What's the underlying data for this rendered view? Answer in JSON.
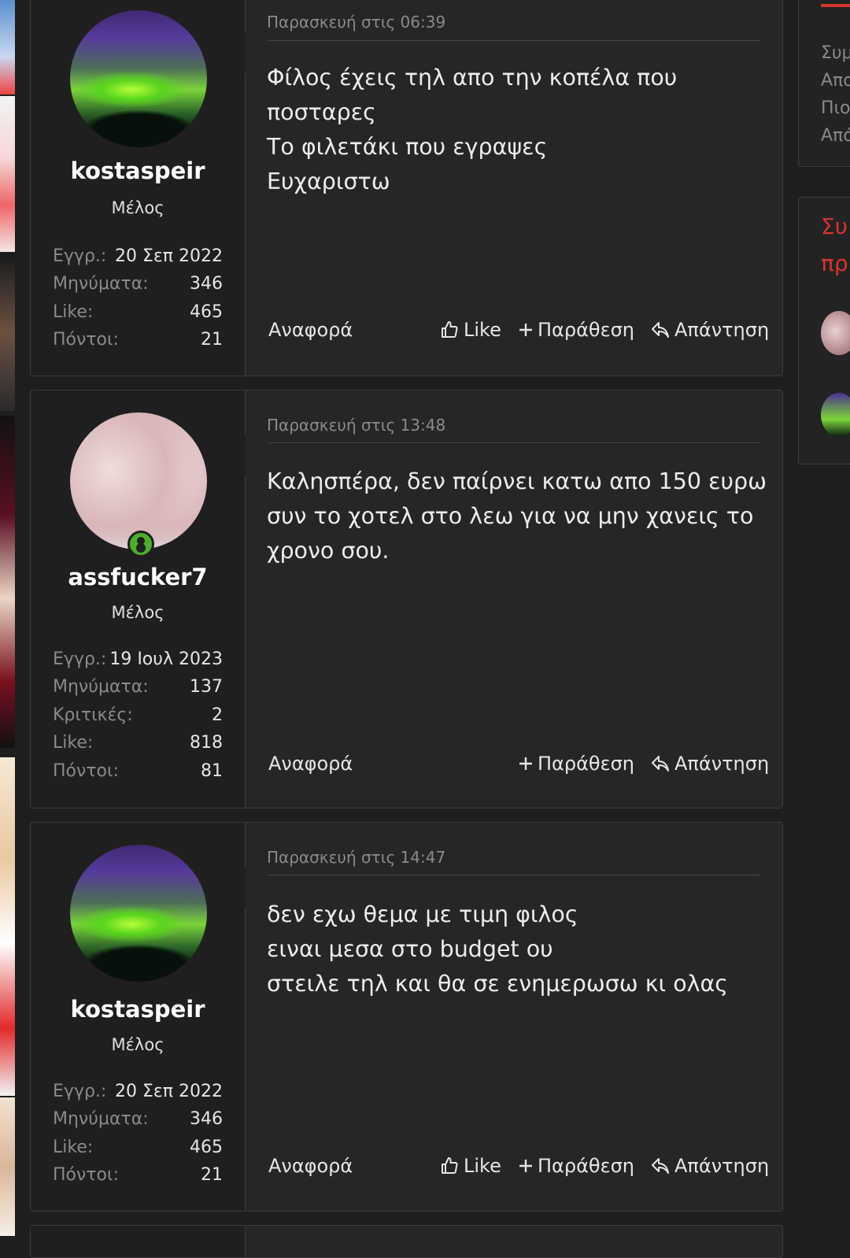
{
  "sidebar_right": {
    "box1_lines": [
      "Συμ",
      "Απο",
      "Πιο",
      "Από"
    ],
    "box2_title_lines": [
      "Συ",
      "πρ"
    ]
  },
  "posts": [
    {
      "username": "kostaspeir",
      "user_title": "Μέλος",
      "stats": [
        {
          "label": "Εγγρ.:",
          "value": "20 Σεπ 2022"
        },
        {
          "label": "Μηνύματα:",
          "value": "346"
        },
        {
          "label": "Like:",
          "value": "465"
        },
        {
          "label": "Πόντοι:",
          "value": "21"
        }
      ],
      "date": "Παρασκευή στις 06:39",
      "body": [
        "Φίλος έχεις τηλ απο την κοπέλα που ποσταρες",
        "Το φιλετάκι που εγραψες",
        "Ευχαριστω"
      ],
      "actions": {
        "report": "Αναφορά",
        "like": "Like",
        "quote": "Παράθεση",
        "reply": "Απάντηση"
      }
    },
    {
      "username": "assfucker7",
      "user_title": "Μέλος",
      "stats": [
        {
          "label": "Εγγρ.:",
          "value": "19 Ιουλ 2023"
        },
        {
          "label": "Μηνύματα:",
          "value": "137"
        },
        {
          "label": "Κριτικές:",
          "value": "2"
        },
        {
          "label": "Like:",
          "value": "818"
        },
        {
          "label": "Πόντοι:",
          "value": "81"
        }
      ],
      "date": "Παρασκευή στις 13:48",
      "body": [
        "Καλησπέρα, δεν παίρνει κατω απο 150 ευρω συν το χοτελ στο λεω για να μην χανεις το χρονο σου."
      ],
      "actions": {
        "report": "Αναφορά",
        "quote": "Παράθεση",
        "reply": "Απάντηση"
      }
    },
    {
      "username": "kostaspeir",
      "user_title": "Μέλος",
      "stats": [
        {
          "label": "Εγγρ.:",
          "value": "20 Σεπ 2022"
        },
        {
          "label": "Μηνύματα:",
          "value": "346"
        },
        {
          "label": "Like:",
          "value": "465"
        },
        {
          "label": "Πόντοι:",
          "value": "21"
        }
      ],
      "date": "Παρασκευή στις 14:47",
      "body": [
        "δεν εχω θεμα με τιμη φιλος",
        "ειναι μεσα στο budget ου",
        "στειλε τηλ και θα σε ενημερωσω κι ολας"
      ],
      "actions": {
        "report": "Αναφορά",
        "like": "Like",
        "quote": "Παράθεση",
        "reply": "Απάντηση"
      }
    }
  ]
}
